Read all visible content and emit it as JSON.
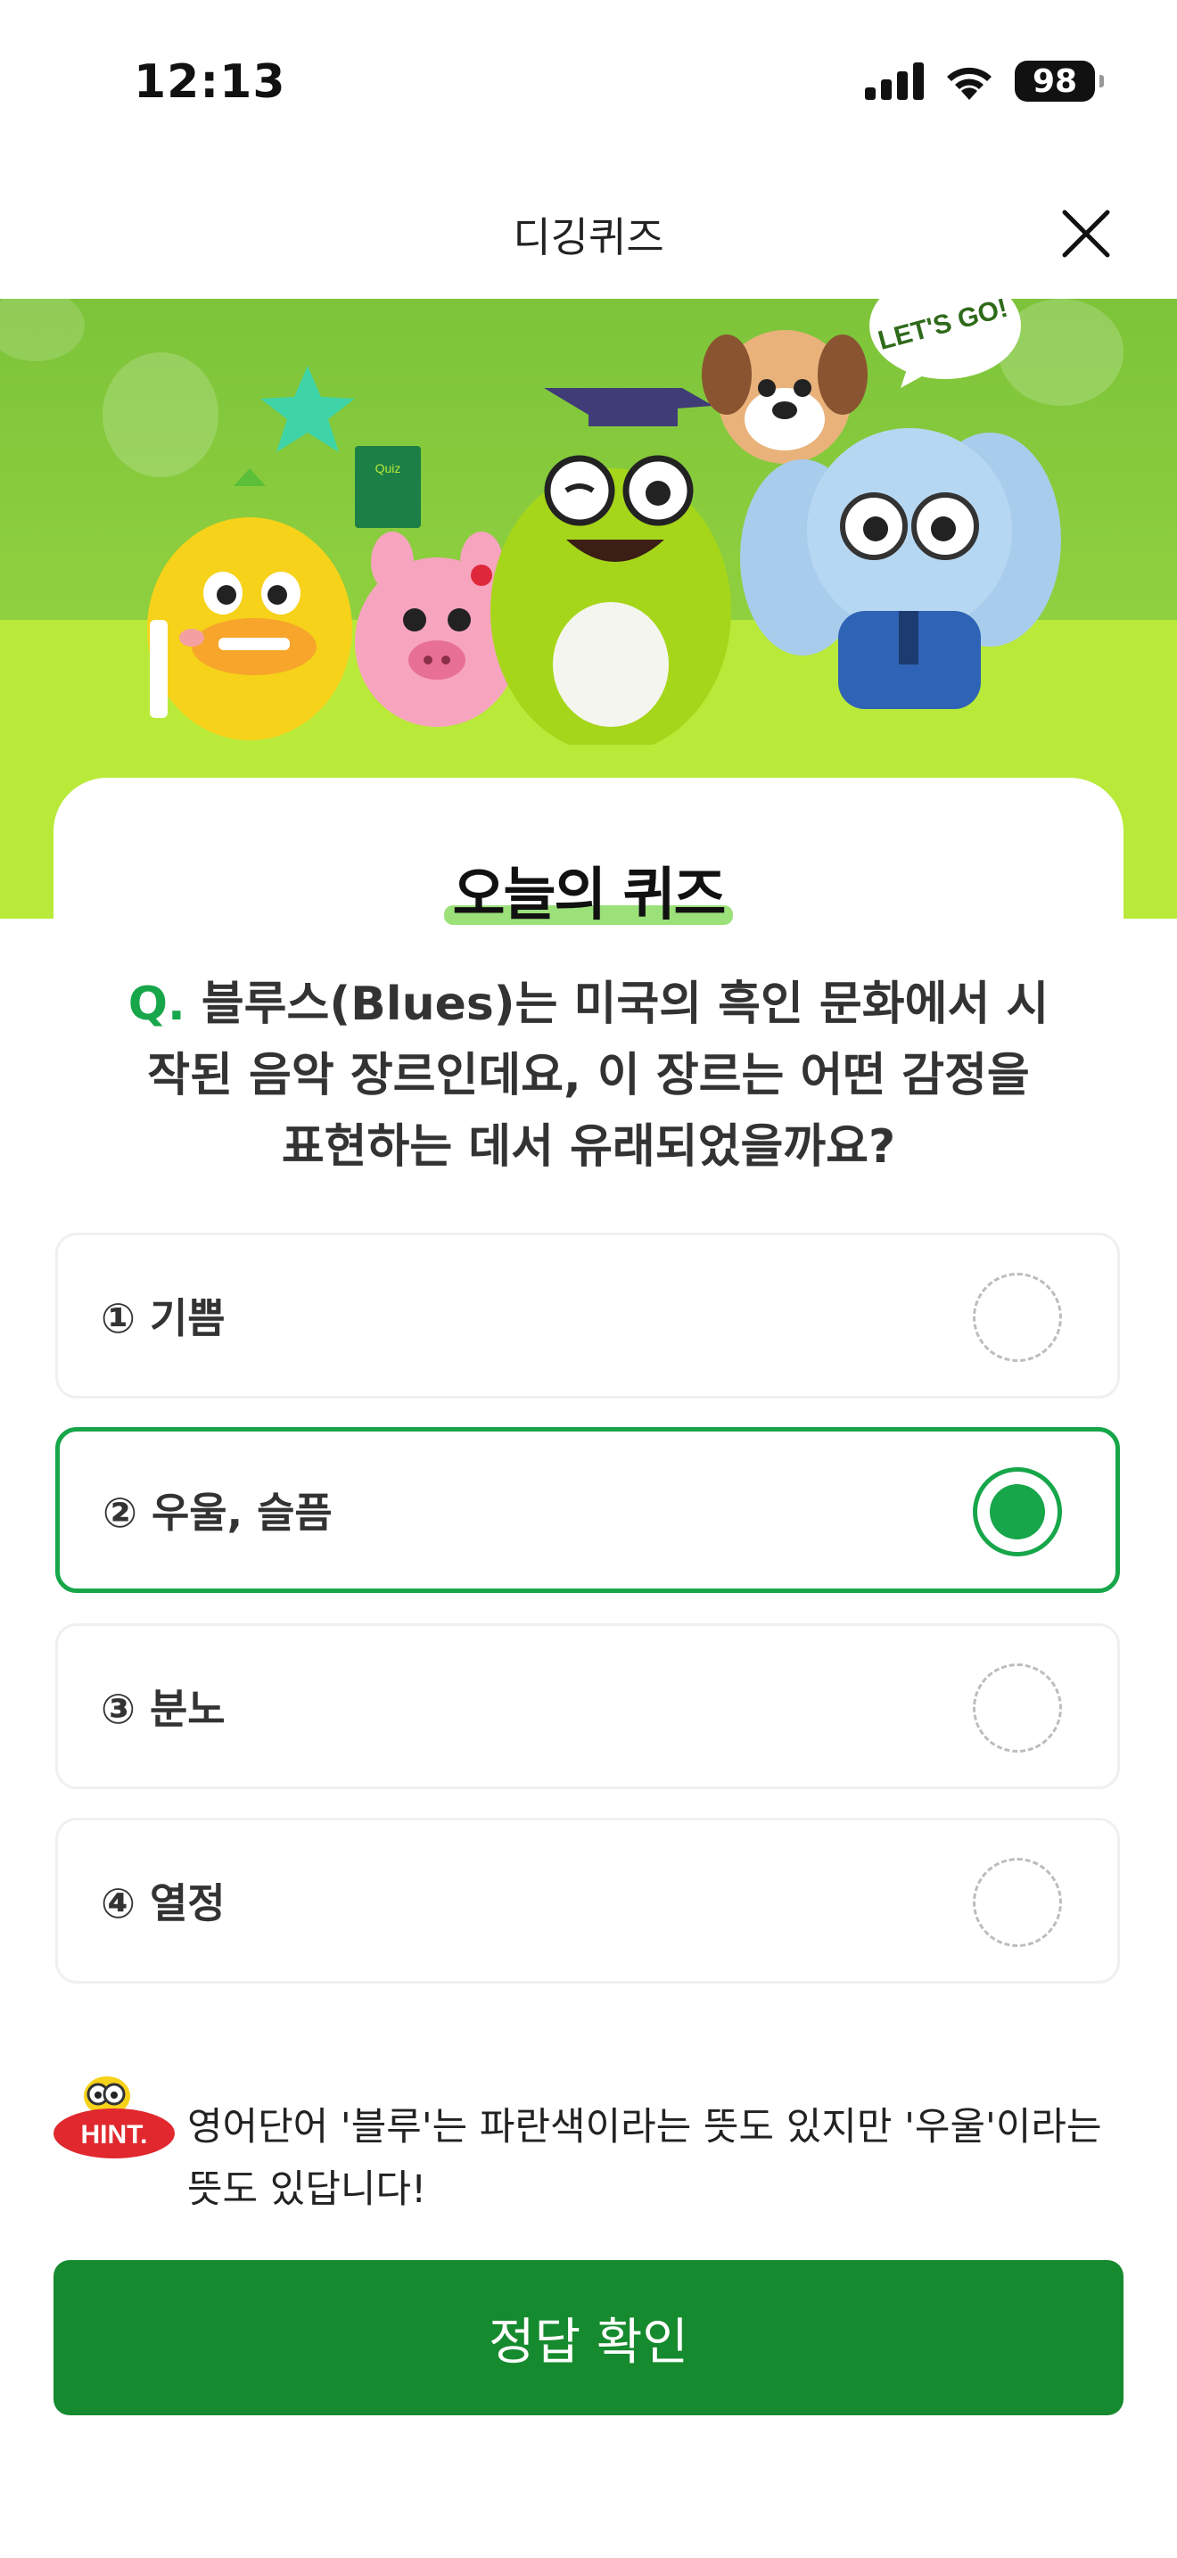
{
  "status_bar": {
    "time": "12:13",
    "battery": "98"
  },
  "nav": {
    "title": "디깅퀴즈"
  },
  "banner": {
    "quiz_badge": "Quiz",
    "speech_bubble": "LET'S GO!"
  },
  "quiz": {
    "title": "오늘의 퀴즈",
    "question_marker": "Q.",
    "question": "블루스(Blues)는 미국의 흑인 문화에서 시작된 음악 장르인데요, 이 장르는 어떤 감정을 표현하는 데서 유래되었을까요?",
    "options": [
      {
        "label": "① 기쁨",
        "selected": false
      },
      {
        "label": "② 우울, 슬픔",
        "selected": true
      },
      {
        "label": "③ 분노",
        "selected": false
      },
      {
        "label": "④ 열정",
        "selected": false
      }
    ]
  },
  "hint": {
    "badge": "HINT.",
    "text": "영어단어 '블루'는 파란색이라는 뜻도 있지만 '우울'이라는 뜻도 있답니다!"
  },
  "confirm_button": {
    "label": "정답 확인"
  },
  "colors": {
    "accent": "#17a64a",
    "button": "#168a2e",
    "banner_top": "#7dc43a",
    "banner_bottom": "#b9ea3a",
    "hint_red": "#e0282e"
  }
}
